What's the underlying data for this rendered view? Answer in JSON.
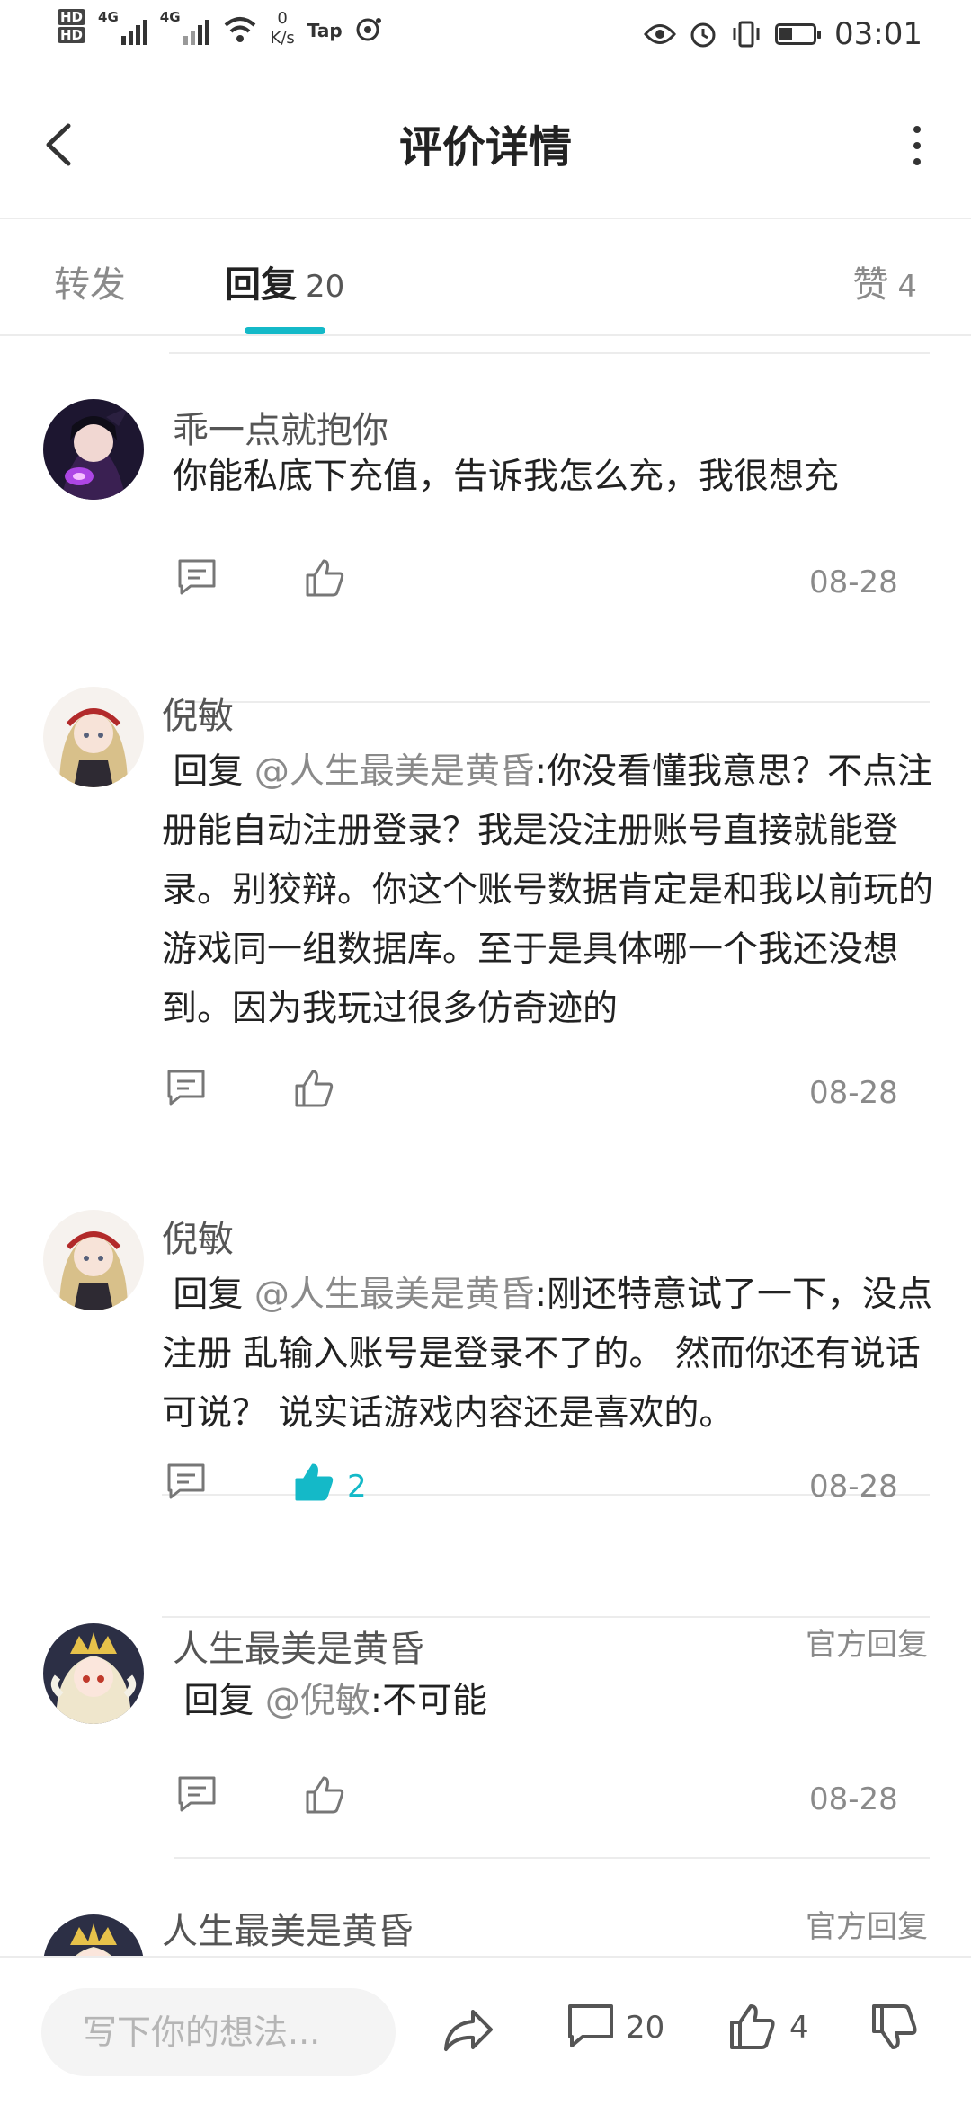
{
  "status_bar": {
    "hd1": "HD",
    "hd2": "HD",
    "net1": "4G",
    "net2": "4G",
    "speed_value": "0",
    "speed_unit": "K/s",
    "tap_label": "Tap",
    "time": "03:01"
  },
  "header": {
    "title": "评价详情"
  },
  "tabs": {
    "repost": "转发",
    "reply": "回复",
    "reply_count": "20",
    "like": "赞",
    "like_count": "4"
  },
  "comments": [
    {
      "name": "乖一点就抱你",
      "text": "你能私底下充值，告诉我怎么充，我很想充",
      "date": "08-28",
      "avatar": "dark-anime-avatar"
    },
    {
      "name": "倪敏",
      "reply_prefix": "回复 ",
      "mention": "@人生最美是黄昏",
      "text": ":你没看懂我意思？不点注册能自动注册登录？我是没注册账号直接就能登录。别狡辩。你这个账号数据肯定是和我以前玩的游戏同一组数据库。至于是具体哪一个我还没想到。因为我玩过很多仿奇迹的",
      "date": "08-28",
      "avatar": "blonde-anime-avatar"
    },
    {
      "name": "倪敏",
      "reply_prefix": "回复 ",
      "mention": "@人生最美是黄昏",
      "text": ":刚还特意试了一下，没点注册 乱输入账号是登录不了的。 然而你还有说话可说？ 说实话游戏内容还是喜欢的。",
      "likes": "2",
      "date": "08-28",
      "avatar": "blonde-anime-avatar"
    },
    {
      "name": "人生最美是黄昏",
      "official": "官方回复",
      "reply_prefix": "回复 ",
      "mention": "@倪敏",
      "text": ":不可能",
      "date": "08-28",
      "avatar": "crowned-anime-avatar"
    },
    {
      "name": "人生最美是黄昏",
      "official": "官方回复",
      "avatar": "crowned-anime-avatar"
    }
  ],
  "bottom_bar": {
    "input_placeholder": "写下你的想法...",
    "comment_count": "20",
    "like_count": "4"
  },
  "colors": {
    "accent": "#14b9c8",
    "muted": "#8a8a8a",
    "text": "#222222"
  }
}
